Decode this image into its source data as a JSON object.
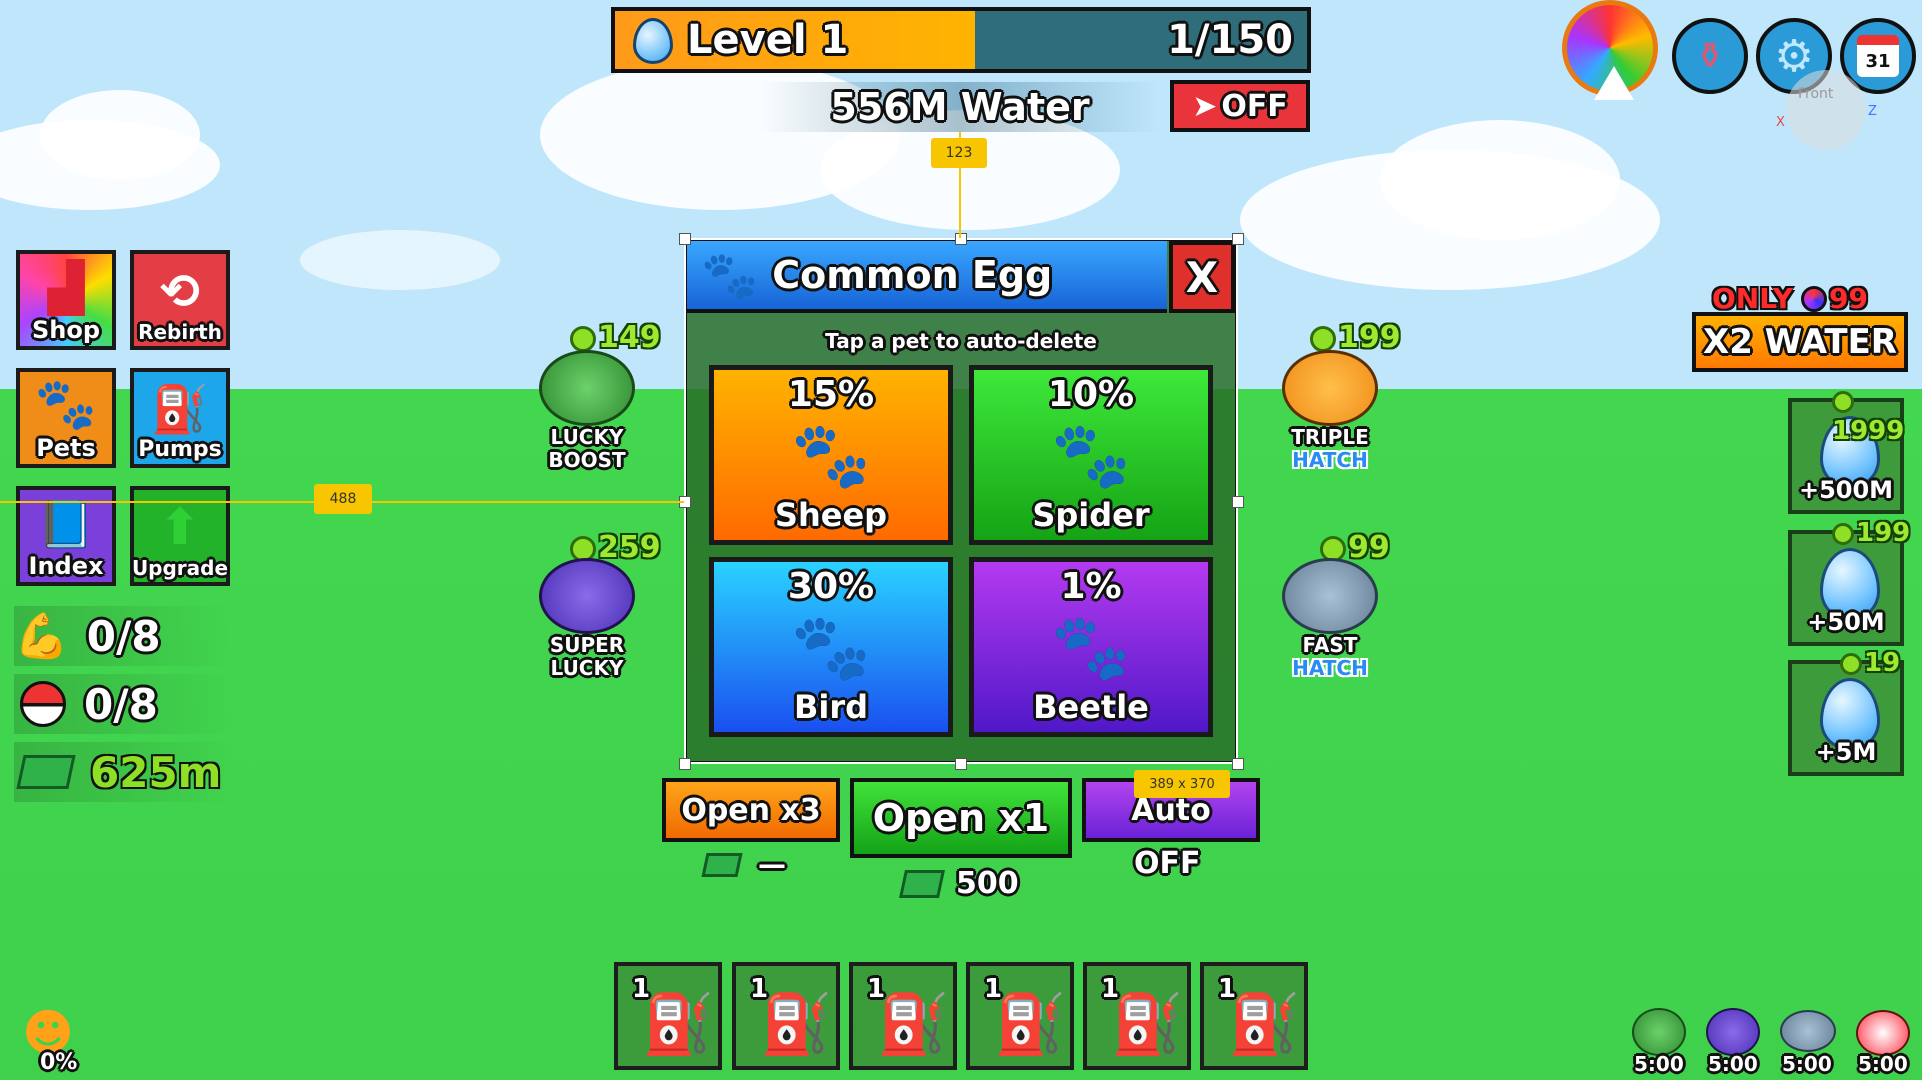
{
  "header": {
    "level_label": "Level 1",
    "level_progress_text": "1/150",
    "level_progress": 0.52,
    "water_text": "556M Water",
    "auto_toggle": "OFF"
  },
  "left_menu": {
    "shop": "Shop",
    "rebirth": "Rebirth",
    "pets": "Pets",
    "pumps": "Pumps",
    "index": "Index",
    "upgrade": "Upgrade"
  },
  "stats": {
    "strength": "0/8",
    "pets_equipped": "0/8",
    "cash": "625m"
  },
  "boosts": {
    "lucky_boost": {
      "price": "149",
      "line1": "LUCKY",
      "line2": "BOOST"
    },
    "super_lucky": {
      "price": "259",
      "line1": "SUPER",
      "line2": "LUCKY"
    },
    "triple_hatch": {
      "price": "199",
      "line1": "TRIPLE",
      "line2": "HATCH"
    },
    "fast_hatch": {
      "price": "99",
      "line1": "FAST",
      "line2": "HATCH"
    }
  },
  "egg_panel": {
    "title": "Common Egg",
    "close": "X",
    "subtitle": "Tap a pet to auto-delete",
    "pets": [
      {
        "chance": "15%",
        "name": "Sheep"
      },
      {
        "chance": "10%",
        "name": "Spider"
      },
      {
        "chance": "30%",
        "name": "Bird"
      },
      {
        "chance": "1%",
        "name": "Beetle"
      }
    ]
  },
  "actions": {
    "open3": "Open x3",
    "open3_cost": "—",
    "open1": "Open x1",
    "open1_cost": "500",
    "auto": "Auto",
    "auto_state": "OFF"
  },
  "promo": {
    "only": "ONLY",
    "price": "99",
    "label": "X2 WATER"
  },
  "water_packs": [
    {
      "price": "1999",
      "amount": "+500M"
    },
    {
      "price": "199",
      "amount": "+50M"
    },
    {
      "price": "19",
      "amount": "+5M"
    }
  ],
  "hotbar": [
    "1",
    "1",
    "1",
    "1",
    "1",
    "1"
  ],
  "luck_percent": "0%",
  "active_timers": [
    "5:00",
    "5:00",
    "5:00",
    "5:00"
  ],
  "calendar_day": "31",
  "editor_overlay": {
    "marker_top": "123",
    "marker_left": "488",
    "marker_size": "389 x 370",
    "gizmo_label": "Front",
    "axis_x": "X",
    "axis_z": "Z"
  },
  "colors": {
    "sky": "#bfe6fb",
    "grass": "#43d64f",
    "panel_header": "#1f8be8",
    "close_red": "#e0302c",
    "editor_yellow": "#f7c600"
  }
}
